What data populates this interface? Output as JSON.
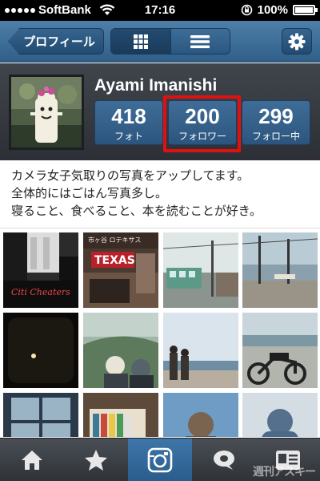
{
  "status_bar": {
    "carrier": "SoftBank",
    "time": "17:16",
    "battery": "100%",
    "battery_level": 1.0
  },
  "nav": {
    "back_label": "プロフィール",
    "grid_view_icon": "grid-icon",
    "list_view_icon": "list-icon",
    "settings_icon": "gear-icon"
  },
  "profile": {
    "username": "Ayami Imanishi",
    "stats": [
      {
        "value": "418",
        "label": "フォト"
      },
      {
        "value": "200",
        "label": "フォロワー"
      },
      {
        "value": "299",
        "label": "フォロー中"
      }
    ],
    "bio_lines": [
      "カメラ女子気取りの写真をアップしてます。",
      "全体的にはごはん写真多し。",
      "寝ること、食べること、本を読むことが好き。"
    ]
  },
  "photos": [
    {
      "signage": "Citi Cheaters"
    },
    {
      "signage": "TEXAS",
      "sub_signage": "市ヶ谷 ロテキサス"
    },
    {},
    {},
    {},
    {},
    {},
    {},
    {},
    {},
    {},
    {}
  ],
  "tabbar": {
    "items": [
      "home-icon",
      "star-icon",
      "camera-icon",
      "speech-bubble-icon",
      "profile-card-icon"
    ],
    "active_index": 2
  },
  "watermark": "週刊アスキー",
  "colors": {
    "nav_blue": "#3d6e98",
    "header_dark": "#3a3f45",
    "highlight_red": "#e01010"
  }
}
